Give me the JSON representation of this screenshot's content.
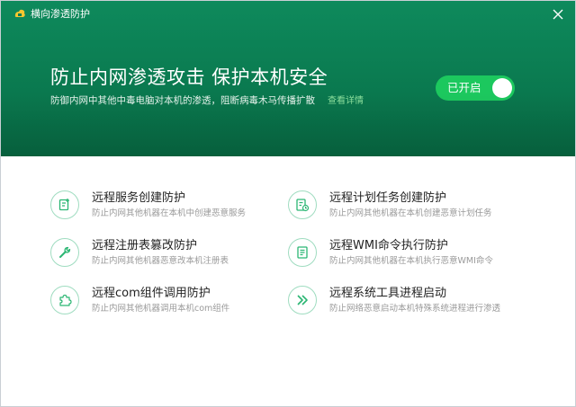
{
  "app": {
    "title": "横向渗透防护"
  },
  "header": {
    "headline": "防止内网渗透攻击 保护本机安全",
    "subline": "防御内网中其他中毒电脑对本机的渗透，阻断病毒木马传播扩散",
    "detail_link": "查看详情",
    "toggle_label": "已开启",
    "toggle_on": true
  },
  "colors": {
    "brand_green": "#0b7d52",
    "toggle_green": "#1cc85e",
    "link_green": "#8fe29f",
    "icon_green": "#2bb673"
  },
  "features": [
    {
      "title": "远程服务创建防护",
      "desc": "防止内网其他机器在本机中创建恶意服务",
      "icon": "service-create-icon"
    },
    {
      "title": "远程计划任务创建防护",
      "desc": "防止内网其他机器在本机创建恶意计划任务",
      "icon": "scheduled-task-icon"
    },
    {
      "title": "远程注册表篡改防护",
      "desc": "防止内网其他机器恶意改本机注册表",
      "icon": "wrench-icon"
    },
    {
      "title": "远程WMI命令执行防护",
      "desc": "防止内网其他机器在本机执行恶意WMI命令",
      "icon": "wmi-command-icon"
    },
    {
      "title": "远程com组件调用防护",
      "desc": "防止内网其他机器调用本机com组件",
      "icon": "puzzle-icon"
    },
    {
      "title": "远程系统工具进程启动",
      "desc": "防止网络恶意启动本机特殊系统进程进行渗透",
      "icon": "forward-arrows-icon"
    }
  ]
}
